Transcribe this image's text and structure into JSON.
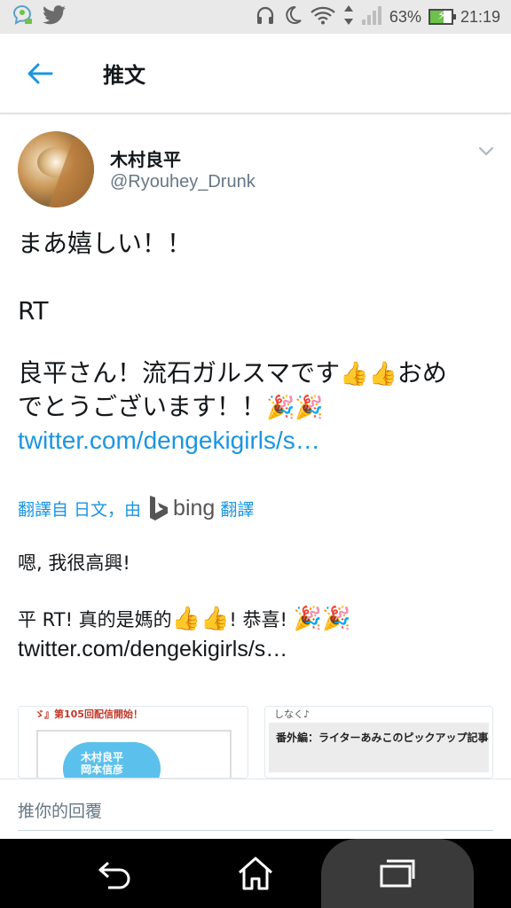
{
  "status_bar": {
    "battery_percent_text": "63%",
    "battery_level": 0.63,
    "time": "21:19",
    "icons": [
      "chat-notification-icon",
      "twitter-bird-icon",
      "headphones-icon",
      "moon-icon",
      "wifi-icon",
      "data-arrows-icon",
      "signal-icon",
      "battery-icon"
    ]
  },
  "header": {
    "title": "推文",
    "back_icon": "arrow-left-icon"
  },
  "tweet": {
    "display_name": "木村良平",
    "handle": "@Ryouhey_Drunk",
    "text_line1": "まあ嬉しい！！",
    "text_line2": "RT",
    "text_line3_a": "良平さん！流石ガルスマです",
    "emoji_thumbs": "👍👍",
    "text_line3_b": "おめ",
    "text_line4": "でとうございます！！",
    "emoji_party": "🎉🎉",
    "link": "twitter.com/dengekigirls/s…"
  },
  "translation": {
    "label_prefix": "翻譯自 日文，由",
    "provider": "bing",
    "label_suffix": "翻譯",
    "line1": "嗯, 我很高興!",
    "line2_a": "平 RT! 真的是媽的",
    "emoji_thumbs": "👍👍",
    "line2_b": "! 恭喜!",
    "emoji_party": "🎉🎉",
    "link": "twitter.com/dengekigirls/s…"
  },
  "cards": {
    "left_strip": "ゞ』第105回配信開始！",
    "left_badge_line1": "木村良平",
    "left_badge_line2": "岡本信彦",
    "right_top": "しなく♪",
    "right_box": "番外編：ライターあみこのピックアップ記事"
  },
  "reply": {
    "placeholder": "推你的回覆"
  },
  "nav": {
    "icons": [
      "back-nav-icon",
      "home-nav-icon",
      "recents-nav-icon"
    ]
  },
  "colors": {
    "link": "#1b95e0",
    "status_bar_bg": "#e9e9e9",
    "nav_bg": "#000000",
    "battery_green": "#6cc24a"
  }
}
